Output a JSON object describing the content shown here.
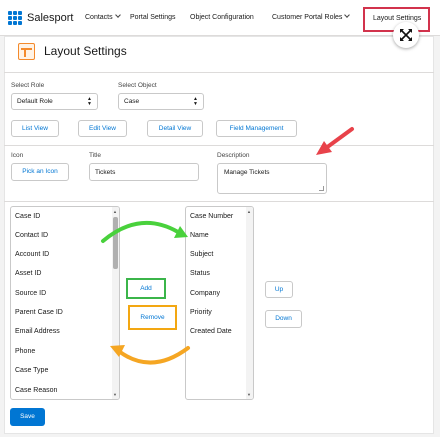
{
  "app": {
    "brand": "Salesport",
    "nav": [
      {
        "label": "Contacts",
        "has_menu": true
      },
      {
        "label": "Portal Settings",
        "has_menu": false
      },
      {
        "label": "Object Configuration",
        "has_menu": false
      },
      {
        "label": "Customer Portal Roles",
        "has_menu": true
      }
    ],
    "active_tab": "Layout Settings"
  },
  "page": {
    "title": "Layout Settings"
  },
  "filters": {
    "role_label": "Select Role",
    "role_value": "Default Role",
    "object_label": "Select Object",
    "object_value": "Case"
  },
  "view_tabs": [
    "List View",
    "Edit View",
    "Detail View",
    "Field Management"
  ],
  "form": {
    "icon_label": "Icon",
    "icon_button": "Pick an Icon",
    "title_label": "Title",
    "title_value": "Tickets",
    "description_label": "Description",
    "description_value": "Manage Tickets"
  },
  "available_fields": [
    "Case ID",
    "Contact ID",
    "Account ID",
    "Asset ID",
    "Source ID",
    "Parent Case ID",
    "Email Address",
    "Phone",
    "Case Type",
    "Case Reason"
  ],
  "selected_fields": [
    "Case Number",
    "Name",
    "Subject",
    "Status",
    "Company",
    "Priority",
    "Created Date"
  ],
  "actions": {
    "add": "Add",
    "remove": "Remove",
    "up": "Up",
    "down": "Down",
    "save": "Save"
  },
  "colors": {
    "brand": "#0176d3",
    "highlight_active_tab": "#d2334c",
    "highlight_add": "#3bb54a",
    "highlight_remove": "#f3a712",
    "arrow_red": "#e8424a",
    "arrow_green": "#49d13c",
    "arrow_orange": "#f5a623"
  },
  "icons": {
    "logo": "grid-dots-icon",
    "expand": "expand-arrows-icon",
    "page": "layout-icon"
  }
}
